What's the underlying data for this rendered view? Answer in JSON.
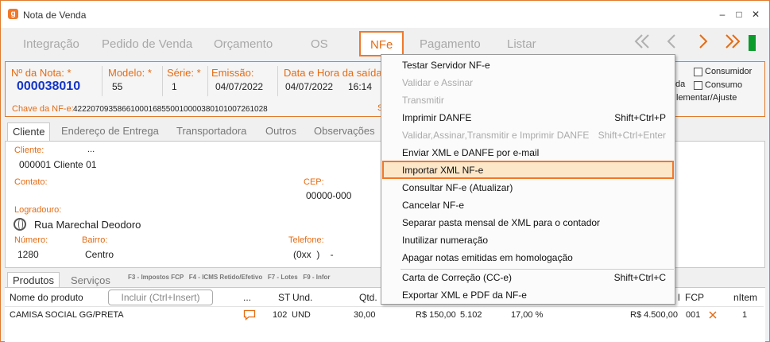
{
  "window": {
    "title": "Nota de Venda",
    "logo_glyph": "g"
  },
  "titlebar": {
    "minimize": "–",
    "maximize": "□",
    "close": "✕"
  },
  "topnav": {
    "tabs": [
      "Integração",
      "Pedido de Venda",
      "Orçamento",
      "OS",
      "NFe",
      "Pagamento",
      "Listar"
    ],
    "active": "NFe",
    "nav_icons": [
      "double-chevron-left-icon",
      "chevron-left-icon",
      "chevron-right-icon",
      "double-chevron-right-icon"
    ]
  },
  "header": {
    "numero_label": "Nº da Nota: *",
    "numero_value": "000038010",
    "modelo_label": "Modelo: *",
    "modelo_value": "55",
    "serie_label": "Série: *",
    "serie_value": "1",
    "emissao_label": "Emissão:",
    "emissao_value": "04/07/2022",
    "saida_label": "Data e Hora da saída",
    "saida_date": "04/07/2022",
    "saida_time": "16:14",
    "chave_label": "Chave da NF-e:",
    "chave_value": "42220709358661000168550010000380101007261028",
    "chave_suffix": "S",
    "consumidor_label": "Consumidor",
    "consumo_label": "Consumo",
    "da_label": "da",
    "complementar_label": "lementar/Ajuste"
  },
  "tabs": [
    "Cliente",
    "Endereço de Entrega",
    "Transportadora",
    "Outros",
    "Observações"
  ],
  "cliente": {
    "cliente_label": "Cliente:",
    "cliente_dots": "...",
    "cliente_value": "000001 Cliente 01",
    "contato_label": "Contato:",
    "cep_label": "CEP:",
    "cep_value": "00000-000",
    "logradouro_label": "Logradouro:",
    "logradouro_value": "Rua Marechal Deodoro",
    "numero_label": "Número:",
    "numero_value": "1280",
    "bairro_label": "Bairro:",
    "bairro_value": "Centro",
    "telefone_label": "Telefone:",
    "telefone_value": "(0xx  )    -"
  },
  "produtos": {
    "tabs": [
      "Produtos",
      "Serviços"
    ],
    "shortcuts": "F3 - Impostos FCP   F4 - ICMS Retido/Efetivo   F7 - Lotes   F9 - Infor",
    "include_button": "Incluir (Ctrl+Insert)",
    "columns": [
      "Nome do produto",
      "...",
      "ST",
      "Und.",
      "Qtd.",
      "l",
      "FCP",
      "nItem"
    ],
    "rows": [
      {
        "nome": "CAMISA SOCIAL GG/PRETA",
        "st": "102",
        "und": "UND",
        "qtd": "30,00",
        "valor": "R$ 150,00",
        "cfop": "5.102",
        "aliq": "17,00 %",
        "total": "R$ 4.500,00",
        "fcp": "001",
        "item": "1"
      }
    ]
  },
  "nfe_menu": {
    "items": [
      {
        "label": "Testar Servidor NF-e",
        "shortcut": "",
        "disabled": false
      },
      {
        "label": "Validar e Assinar",
        "shortcut": "",
        "disabled": true
      },
      {
        "label": "Transmitir",
        "shortcut": "",
        "disabled": true
      },
      {
        "label": "Imprimir DANFE",
        "shortcut": "Shift+Ctrl+P",
        "disabled": false
      },
      {
        "label": "Validar,Assinar,Transmitir e Imprimir DANFE",
        "shortcut": "Shift+Ctrl+Enter",
        "disabled": true
      },
      {
        "label": "Enviar XML e DANFE por e-mail",
        "shortcut": "",
        "disabled": false
      },
      {
        "label": "Importar XML NF-e",
        "shortcut": "",
        "disabled": false,
        "highlighted": true
      },
      {
        "label": "Consultar NF-e (Atualizar)",
        "shortcut": "",
        "disabled": false
      },
      {
        "label": "Cancelar NF-e",
        "shortcut": "",
        "disabled": false
      },
      {
        "label": "Separar pasta mensal de XML para o contador",
        "shortcut": "",
        "disabled": false
      },
      {
        "label": "Inutilizar numeração",
        "shortcut": "",
        "disabled": false
      },
      {
        "label": "Apagar notas emitidas em homologação",
        "shortcut": "",
        "disabled": false
      },
      {
        "label": "Carta de Correção (CC-e)",
        "shortcut": "Shift+Ctrl+C",
        "disabled": false
      },
      {
        "label": "Exportar XML e PDF da NF-e",
        "shortcut": "",
        "disabled": false
      }
    ]
  },
  "colors": {
    "accent": "#f0782a",
    "label": "#e56b12",
    "number": "#1535c8",
    "green": "#0a9b2b"
  }
}
